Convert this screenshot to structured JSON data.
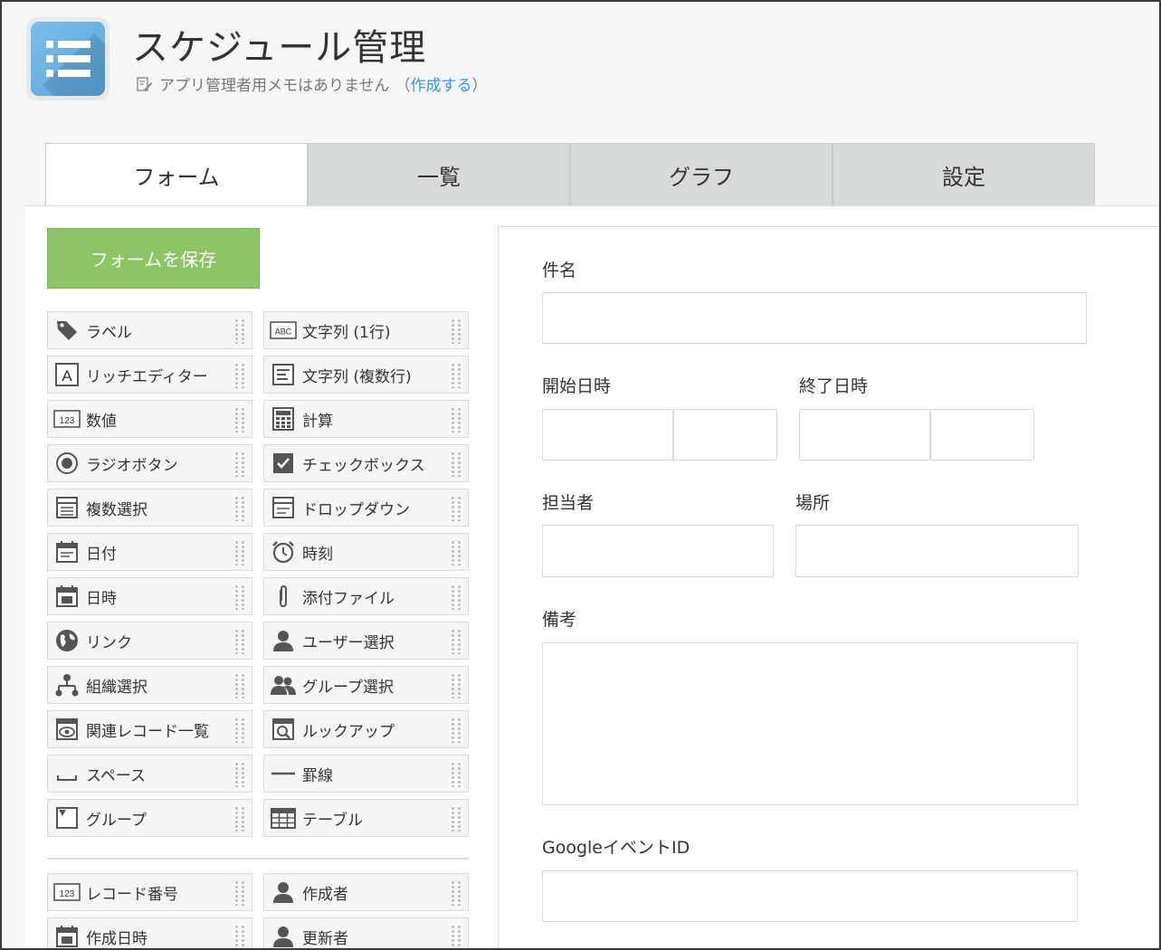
{
  "app": {
    "title": "スケジュール管理",
    "memo_text": "アプリ管理者用メモはありません",
    "memo_paren_open": "（",
    "memo_link": "作成する",
    "memo_paren_close": "）"
  },
  "tabs": [
    {
      "label": "フォーム",
      "active": true
    },
    {
      "label": "一覧",
      "active": false
    },
    {
      "label": "グラフ",
      "active": false
    },
    {
      "label": "設定",
      "active": false
    }
  ],
  "save_button": "フォームを保存",
  "palette": {
    "left": [
      {
        "label": "ラベル",
        "icon": "tag-icon"
      },
      {
        "label": "リッチエディター",
        "icon": "rich-editor-icon"
      },
      {
        "label": "数値",
        "icon": "number-icon"
      },
      {
        "label": "ラジオボタン",
        "icon": "radio-icon"
      },
      {
        "label": "複数選択",
        "icon": "multi-select-icon"
      },
      {
        "label": "日付",
        "icon": "calendar-icon"
      },
      {
        "label": "日時",
        "icon": "datetime-icon"
      },
      {
        "label": "リンク",
        "icon": "globe-icon"
      },
      {
        "label": "組織選択",
        "icon": "org-icon"
      },
      {
        "label": "関連レコード一覧",
        "icon": "related-records-icon"
      },
      {
        "label": "スペース",
        "icon": "space-icon"
      },
      {
        "label": "グループ",
        "icon": "group-field-icon"
      }
    ],
    "right": [
      {
        "label": "文字列 (1行)",
        "icon": "abc-icon"
      },
      {
        "label": "文字列 (複数行)",
        "icon": "multiline-icon"
      },
      {
        "label": "計算",
        "icon": "calculator-icon"
      },
      {
        "label": "チェックボックス",
        "icon": "checkbox-icon"
      },
      {
        "label": "ドロップダウン",
        "icon": "dropdown-icon"
      },
      {
        "label": "時刻",
        "icon": "clock-icon"
      },
      {
        "label": "添付ファイル",
        "icon": "paperclip-icon"
      },
      {
        "label": "ユーザー選択",
        "icon": "user-icon"
      },
      {
        "label": "グループ選択",
        "icon": "users-icon"
      },
      {
        "label": "ルックアップ",
        "icon": "lookup-icon"
      },
      {
        "label": "罫線",
        "icon": "line-icon"
      },
      {
        "label": "テーブル",
        "icon": "table-icon"
      }
    ],
    "system_left": [
      {
        "label": "レコード番号",
        "icon": "number-icon"
      },
      {
        "label": "作成日時",
        "icon": "datetime-icon"
      }
    ],
    "system_right": [
      {
        "label": "作成者",
        "icon": "user-icon"
      },
      {
        "label": "更新者",
        "icon": "user-icon"
      }
    ]
  },
  "form": {
    "subject": "件名",
    "start": "開始日時",
    "end": "終了日時",
    "assignee": "担当者",
    "location": "場所",
    "notes": "備考",
    "google_event_id": "GoogleイベントID"
  },
  "colors": {
    "save_button": "#8bc565",
    "link": "#3498db",
    "app_icon": "#5aa6db"
  }
}
